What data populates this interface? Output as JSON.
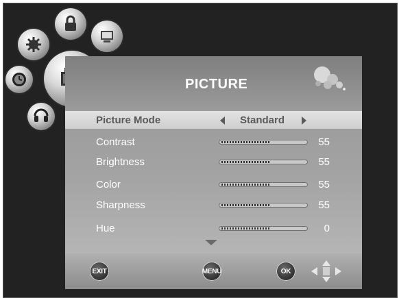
{
  "menu_title": "PICTURE",
  "items": [
    {
      "label": "Picture Mode",
      "value": "Standard",
      "selected": true
    },
    {
      "label": "Contrast",
      "value": "55",
      "level": 0.55
    },
    {
      "label": "Brightness",
      "value": "55",
      "level": 0.55
    },
    {
      "label": "Color",
      "value": "55",
      "level": 0.55
    },
    {
      "label": "Sharpness",
      "value": "55",
      "level": 0.55
    },
    {
      "label": "Hue",
      "value": "0",
      "level": 0.55
    }
  ],
  "buttons": {
    "exit": "EXIT",
    "menu": "MENU",
    "ok": "OK"
  },
  "icons": [
    "lock-icon",
    "settings-icon",
    "screen-icon",
    "picture-icon",
    "clock-icon",
    "sound-icon",
    "dpad-icon",
    "scroll-down-arrow-icon"
  ]
}
